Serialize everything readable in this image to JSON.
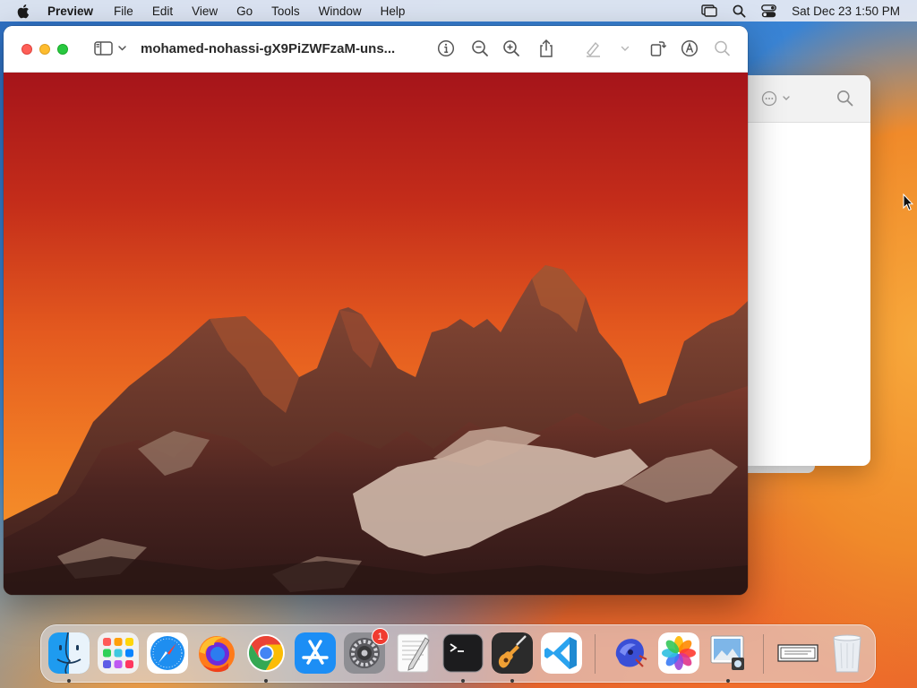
{
  "menubar": {
    "app_name": "Preview",
    "items": [
      "File",
      "Edit",
      "View",
      "Go",
      "Tools",
      "Window",
      "Help"
    ],
    "clock": "Sat Dec 23  1:50 PM"
  },
  "window": {
    "document_title": "mohamed-nohassi-gX9PiZWFzaM-uns..."
  },
  "dock": {
    "items": [
      {
        "name": "Finder",
        "running": true
      },
      {
        "name": "Launchpad",
        "running": false
      },
      {
        "name": "Safari",
        "running": false
      },
      {
        "name": "Firefox",
        "running": false
      },
      {
        "name": "Google Chrome",
        "running": true
      },
      {
        "name": "App Store",
        "running": false
      },
      {
        "name": "System Settings",
        "running": false,
        "badge": "1"
      },
      {
        "name": "TextEdit",
        "running": false
      },
      {
        "name": "Terminal",
        "running": true
      },
      {
        "name": "GarageBand",
        "running": true
      },
      {
        "name": "Visual Studio Code",
        "running": false
      },
      {
        "name": "Unknown App",
        "running": false
      },
      {
        "name": "Photos",
        "running": false
      },
      {
        "name": "Preview",
        "running": true
      },
      {
        "name": "Document",
        "running": false
      },
      {
        "name": "Trash",
        "running": false
      }
    ]
  },
  "colors": {
    "close": "#fe5f57",
    "minimize": "#febc2e",
    "maximize": "#28c840",
    "badge": "#f03b30"
  }
}
